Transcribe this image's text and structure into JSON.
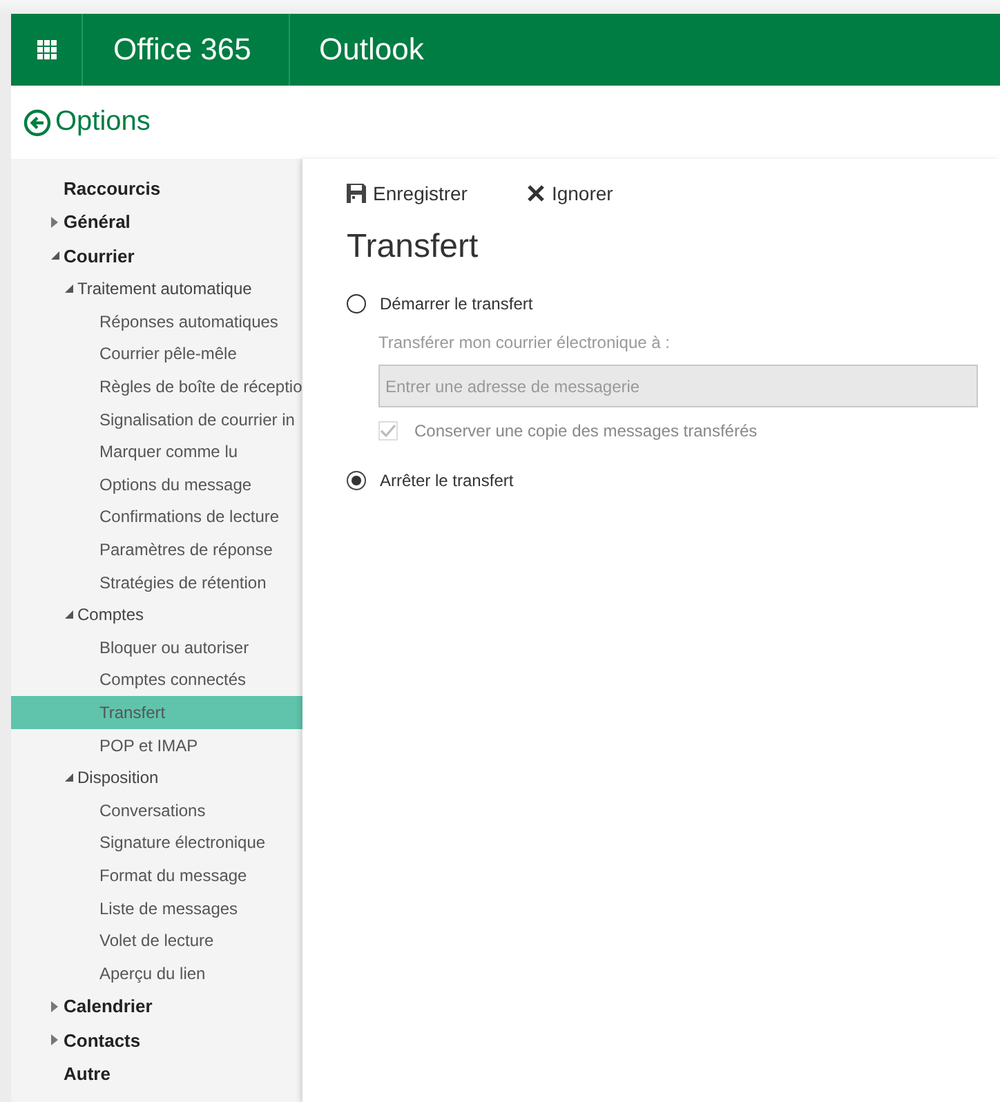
{
  "app_bar": {
    "suite": "Office 365",
    "app": "Outlook"
  },
  "page_title": "Options",
  "sidebar": {
    "items": [
      {
        "label": "Raccourcis",
        "selected": false
      },
      {
        "label": "Général",
        "expanded": false,
        "selected": false
      },
      {
        "label": "Courrier",
        "expanded": true,
        "selected": false,
        "children": [
          {
            "label": "Traitement automatique",
            "expanded": true,
            "selected": false,
            "children": [
              {
                "label": "Réponses automatiques",
                "selected": false
              },
              {
                "label": "Courrier pêle-mêle",
                "selected": false
              },
              {
                "label": "Règles de boîte de réceptio",
                "selected": false
              },
              {
                "label": "Signalisation de courrier in",
                "selected": false
              },
              {
                "label": "Marquer comme lu",
                "selected": false
              },
              {
                "label": "Options du message",
                "selected": false
              },
              {
                "label": "Confirmations de lecture",
                "selected": false
              },
              {
                "label": "Paramètres de réponse",
                "selected": false
              },
              {
                "label": "Stratégies de rétention",
                "selected": false
              }
            ]
          },
          {
            "label": "Comptes",
            "expanded": true,
            "selected": false,
            "children": [
              {
                "label": "Bloquer ou autoriser",
                "selected": false
              },
              {
                "label": "Comptes connectés",
                "selected": false
              },
              {
                "label": "Transfert",
                "selected": true
              },
              {
                "label": "POP et IMAP",
                "selected": false
              }
            ]
          },
          {
            "label": "Disposition",
            "expanded": true,
            "selected": false,
            "children": [
              {
                "label": "Conversations",
                "selected": false
              },
              {
                "label": "Signature électronique",
                "selected": false
              },
              {
                "label": "Format du message",
                "selected": false
              },
              {
                "label": "Liste de messages",
                "selected": false
              },
              {
                "label": "Volet de lecture",
                "selected": false
              },
              {
                "label": "Aperçu du lien",
                "selected": false
              }
            ]
          }
        ]
      },
      {
        "label": "Calendrier",
        "expanded": false,
        "selected": false
      },
      {
        "label": "Contacts",
        "expanded": false,
        "selected": false
      },
      {
        "label": "Autre",
        "selected": false
      }
    ]
  },
  "toolbar": [
    {
      "kind": "save",
      "label": "Enregistrer"
    },
    {
      "kind": "discard",
      "label": "Ignorer"
    }
  ],
  "heading": "Transfert",
  "options": [
    {
      "label": "Démarrer le transfert",
      "selected": false,
      "field_label": "Transférer mon courrier électronique à :",
      "field": {
        "placeholder": "Entrer une adresse de messagerie",
        "disabled": true
      },
      "checkbox": {
        "label": "Conserver une copie des messages transférés",
        "checked": true,
        "disabled": true
      }
    },
    {
      "label": "Arrêter le transfert",
      "selected": true
    }
  ]
}
